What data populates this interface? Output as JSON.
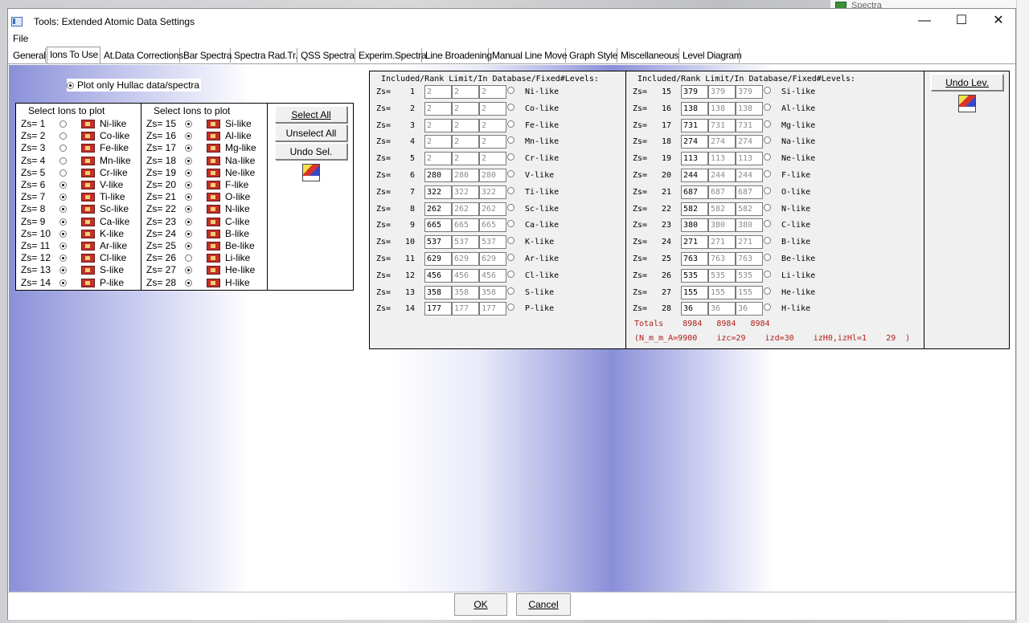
{
  "background": {
    "window_title": "Spectra"
  },
  "window": {
    "title": "Tools: Extended Atomic Data Settings",
    "minimize_glyph": "—",
    "maximize_glyph": "☐",
    "close_glyph": "✕"
  },
  "menu": {
    "file": "File"
  },
  "tabs": [
    "General",
    "Ions To Use",
    "At.Data Corrections",
    "Bar Spectra",
    "Spectra Rad.Tr.",
    "QSS Spectra",
    "Experim.Spectra",
    "Line Broadening",
    "Manual Line Move",
    "Graph Style",
    "Miscellaneous",
    "Level Diagram"
  ],
  "active_tab": "Ions To Use",
  "plot_only": {
    "label": "Plot only Hullac data/spectra",
    "checked": true
  },
  "select_ions": {
    "header1": "Select Ions to plot",
    "header2": "Select Ions to plot",
    "col1": [
      {
        "zs": "Zs= 1",
        "like": "Ni-like",
        "checked": false
      },
      {
        "zs": "Zs= 2",
        "like": "Co-like",
        "checked": false
      },
      {
        "zs": "Zs= 3",
        "like": "Fe-like",
        "checked": false
      },
      {
        "zs": "Zs= 4",
        "like": "Mn-like",
        "checked": false
      },
      {
        "zs": "Zs= 5",
        "like": "Cr-like",
        "checked": false
      },
      {
        "zs": "Zs= 6",
        "like": "V-like",
        "checked": true
      },
      {
        "zs": "Zs= 7",
        "like": "Ti-like",
        "checked": true
      },
      {
        "zs": "Zs= 8",
        "like": "Sc-like",
        "checked": true
      },
      {
        "zs": "Zs= 9",
        "like": "Ca-like",
        "checked": true
      },
      {
        "zs": "Zs= 10",
        "like": "K-like",
        "checked": true
      },
      {
        "zs": "Zs= 11",
        "like": "Ar-like",
        "checked": true
      },
      {
        "zs": "Zs= 12",
        "like": "Cl-like",
        "checked": true
      },
      {
        "zs": "Zs= 13",
        "like": "S-like",
        "checked": true
      },
      {
        "zs": "Zs= 14",
        "like": "P-like",
        "checked": true
      }
    ],
    "col2": [
      {
        "zs": "Zs= 15",
        "like": "Si-like",
        "checked": true
      },
      {
        "zs": "Zs= 16",
        "like": "Al-like",
        "checked": true
      },
      {
        "zs": "Zs= 17",
        "like": "Mg-like",
        "checked": true
      },
      {
        "zs": "Zs= 18",
        "like": "Na-like",
        "checked": true
      },
      {
        "zs": "Zs= 19",
        "like": "Ne-like",
        "checked": true
      },
      {
        "zs": "Zs= 20",
        "like": "F-like",
        "checked": true
      },
      {
        "zs": "Zs= 21",
        "like": "O-like",
        "checked": true
      },
      {
        "zs": "Zs= 22",
        "like": "N-like",
        "checked": true
      },
      {
        "zs": "Zs= 23",
        "like": "C-like",
        "checked": true
      },
      {
        "zs": "Zs= 24",
        "like": "B-like",
        "checked": true
      },
      {
        "zs": "Zs= 25",
        "like": "Be-like",
        "checked": true
      },
      {
        "zs": "Zs= 26",
        "like": "Li-like",
        "checked": false
      },
      {
        "zs": "Zs= 27",
        "like": "He-like",
        "checked": true
      },
      {
        "zs": "Zs= 28",
        "like": "H-like",
        "checked": true
      }
    ],
    "select_all": "Select  All",
    "unselect_all": "Unselect All",
    "undo_sel": "Undo Sel.",
    "graphs_icon": "graphs-icon"
  },
  "levels": {
    "header1": "Included/Rank Limit/In Database/Fixed#Levels:",
    "header2": "Included/Rank Limit/In Database/Fixed#Levels:",
    "col1": [
      {
        "zs": "Zs=",
        "z": "1",
        "v1": "2",
        "v2": "2",
        "v3": "2",
        "like": "Ni-like",
        "enabled": false
      },
      {
        "zs": "Zs=",
        "z": "2",
        "v1": "2",
        "v2": "2",
        "v3": "2",
        "like": "Co-like",
        "enabled": false
      },
      {
        "zs": "Zs=",
        "z": "3",
        "v1": "2",
        "v2": "2",
        "v3": "2",
        "like": "Fe-like",
        "enabled": false
      },
      {
        "zs": "Zs=",
        "z": "4",
        "v1": "2",
        "v2": "2",
        "v3": "2",
        "like": "Mn-like",
        "enabled": false
      },
      {
        "zs": "Zs=",
        "z": "5",
        "v1": "2",
        "v2": "2",
        "v3": "2",
        "like": "Cr-like",
        "enabled": false
      },
      {
        "zs": "Zs=",
        "z": "6",
        "v1": "280",
        "v2": "280",
        "v3": "280",
        "like": "V-like",
        "enabled": true
      },
      {
        "zs": "Zs=",
        "z": "7",
        "v1": "322",
        "v2": "322",
        "v3": "322",
        "like": "Ti-like",
        "enabled": true
      },
      {
        "zs": "Zs=",
        "z": "8",
        "v1": "262",
        "v2": "262",
        "v3": "262",
        "like": "Sc-like",
        "enabled": true
      },
      {
        "zs": "Zs=",
        "z": "9",
        "v1": "665",
        "v2": "665",
        "v3": "665",
        "like": "Ca-like",
        "enabled": true
      },
      {
        "zs": "Zs=",
        "z": "10",
        "v1": "537",
        "v2": "537",
        "v3": "537",
        "like": "K-like",
        "enabled": true
      },
      {
        "zs": "Zs=",
        "z": "11",
        "v1": "629",
        "v2": "629",
        "v3": "629",
        "like": "Ar-like",
        "enabled": true
      },
      {
        "zs": "Zs=",
        "z": "12",
        "v1": "456",
        "v2": "456",
        "v3": "456",
        "like": "Cl-like",
        "enabled": true
      },
      {
        "zs": "Zs=",
        "z": "13",
        "v1": "358",
        "v2": "358",
        "v3": "358",
        "like": "S-like",
        "enabled": true
      },
      {
        "zs": "Zs=",
        "z": "14",
        "v1": "177",
        "v2": "177",
        "v3": "177",
        "like": "P-like",
        "enabled": true
      }
    ],
    "col2": [
      {
        "zs": "Zs=",
        "z": "15",
        "v1": "379",
        "v2": "379",
        "v3": "379",
        "like": "Si-like",
        "enabled": true
      },
      {
        "zs": "Zs=",
        "z": "16",
        "v1": "138",
        "v2": "138",
        "v3": "138",
        "like": "Al-like",
        "enabled": true
      },
      {
        "zs": "Zs=",
        "z": "17",
        "v1": "731",
        "v2": "731",
        "v3": "731",
        "like": "Mg-like",
        "enabled": true
      },
      {
        "zs": "Zs=",
        "z": "18",
        "v1": "274",
        "v2": "274",
        "v3": "274",
        "like": "Na-like",
        "enabled": true
      },
      {
        "zs": "Zs=",
        "z": "19",
        "v1": "113",
        "v2": "113",
        "v3": "113",
        "like": "Ne-like",
        "enabled": true
      },
      {
        "zs": "Zs=",
        "z": "20",
        "v1": "244",
        "v2": "244",
        "v3": "244",
        "like": "F-like",
        "enabled": true
      },
      {
        "zs": "Zs=",
        "z": "21",
        "v1": "687",
        "v2": "687",
        "v3": "687",
        "like": "O-like",
        "enabled": true
      },
      {
        "zs": "Zs=",
        "z": "22",
        "v1": "582",
        "v2": "582",
        "v3": "582",
        "like": "N-like",
        "enabled": true
      },
      {
        "zs": "Zs=",
        "z": "23",
        "v1": "380",
        "v2": "380",
        "v3": "380",
        "like": "C-like",
        "enabled": true
      },
      {
        "zs": "Zs=",
        "z": "24",
        "v1": "271",
        "v2": "271",
        "v3": "271",
        "like": "B-like",
        "enabled": true
      },
      {
        "zs": "Zs=",
        "z": "25",
        "v1": "763",
        "v2": "763",
        "v3": "763",
        "like": "Be-like",
        "enabled": true
      },
      {
        "zs": "Zs=",
        "z": "26",
        "v1": "535",
        "v2": "535",
        "v3": "535",
        "like": "Li-like",
        "enabled": true
      },
      {
        "zs": "Zs=",
        "z": "27",
        "v1": "155",
        "v2": "155",
        "v3": "155",
        "like": "He-like",
        "enabled": true
      },
      {
        "zs": "Zs=",
        "z": "28",
        "v1": "36",
        "v2": "36",
        "v3": "36",
        "like": "H-like",
        "enabled": true
      }
    ],
    "totals": "Totals    8984   8984   8984",
    "params": "(N_m_m_A=9900    izc=29    izd=30    izH0,izHl=1    29  )",
    "undo_lev": "Undo Lev.",
    "graphs_icon": "graphs-icon"
  },
  "footer": {
    "ok": "OK",
    "cancel": "Cancel"
  },
  "colors": {
    "accent_red": "#b0201a",
    "gradient_blue": "#8a90d8"
  }
}
